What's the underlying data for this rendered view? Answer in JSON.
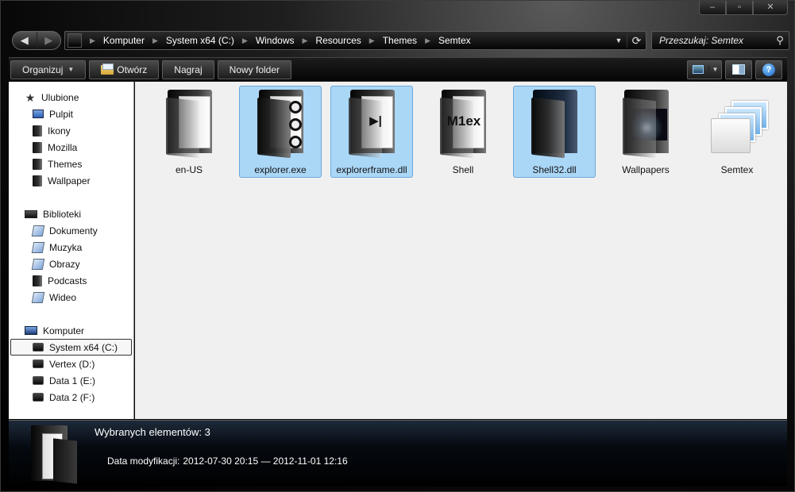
{
  "window": {
    "controls": {
      "minimize": "–",
      "maximize": "▫",
      "close": "✕"
    }
  },
  "nav": {
    "back": "◀",
    "forward": "▶"
  },
  "address": {
    "breadcrumbs": [
      "Komputer",
      "System x64 (C:)",
      "Windows",
      "Resources",
      "Themes",
      "Semtex"
    ],
    "dropdown": "▼",
    "refresh": "⟳"
  },
  "search": {
    "placeholder": "Przeszukaj: Semtex",
    "icon": "⚲"
  },
  "toolbar": {
    "organize": "Organizuj",
    "open": "Otwórz",
    "burn": "Nagraj",
    "new_folder": "Nowy folder",
    "help": "?"
  },
  "sidebar": {
    "favorites": {
      "label": "Ulubione",
      "items": [
        "Pulpit",
        "Ikony",
        "Mozilla",
        "Themes",
        "Wallpaper"
      ]
    },
    "libraries": {
      "label": "Biblioteki",
      "items": [
        "Dokumenty",
        "Muzyka",
        "Obrazy",
        "Podcasts",
        "Wideo"
      ]
    },
    "computer": {
      "label": "Komputer",
      "items": [
        "System x64 (C:)",
        "Vertex (D:)",
        "Data 1 (E:)",
        "Data 2 (F:)"
      ],
      "selected": "System x64 (C:)"
    }
  },
  "files": [
    {
      "name": "en-US",
      "selected": false
    },
    {
      "name": "explorer.exe",
      "selected": true
    },
    {
      "name": "explorerframe.dll",
      "selected": true
    },
    {
      "name": "Shell",
      "selected": false
    },
    {
      "name": "Shell32.dll",
      "selected": true
    },
    {
      "name": "Wallpapers",
      "selected": false
    },
    {
      "name": "Semtex",
      "selected": false
    }
  ],
  "glyphs": {
    "shell": "M1ex",
    "explorerframe": "▶|"
  },
  "details": {
    "title": "Wybranych elementów: 3",
    "prop_label": "Data modyfikacji:",
    "prop_value": "2012-07-30 20:15 — 2012-11-01 12:16"
  },
  "colors": {
    "selection": "#abd7f7",
    "selection_border": "#6aa8db",
    "chrome": "#000000"
  }
}
